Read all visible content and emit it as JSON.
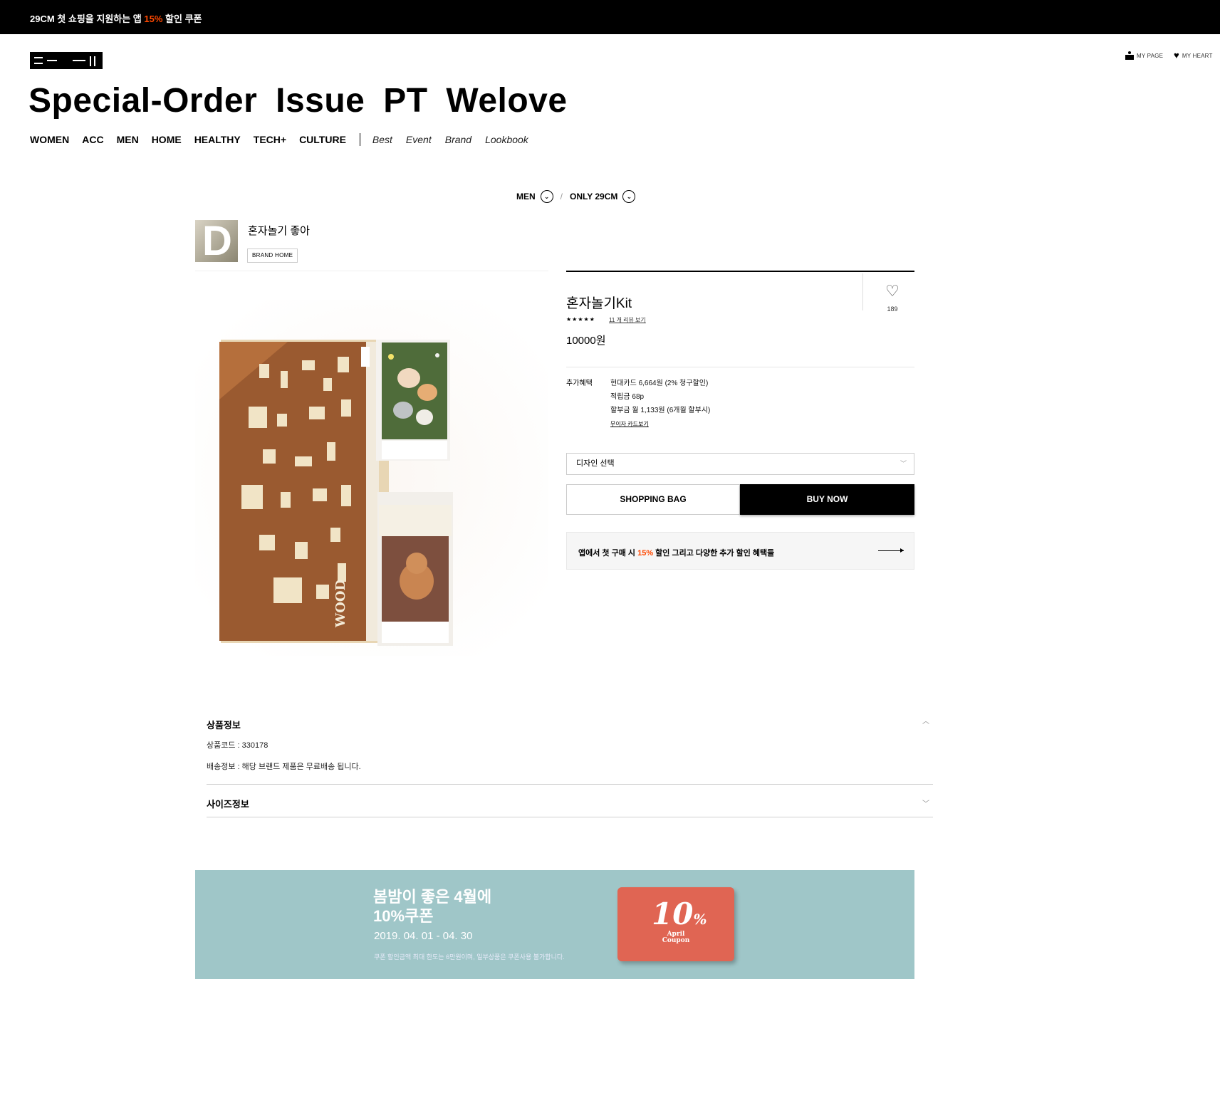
{
  "topbar": {
    "promo_prefix": "29CM 첫 쇼핑을 지원하는 앱 ",
    "promo_accent": "15%",
    "promo_suffix": " 할인 쿠폰",
    "accent_color": "#ff4800"
  },
  "header": {
    "logo_icon": "29cm-logo-icon",
    "utility": [
      {
        "label": "MY PAGE",
        "icon": "person-icon"
      },
      {
        "label": "MY HEART",
        "icon": "heart-icon"
      }
    ],
    "hero_title": "Special-Order  Issue  PT  Welove",
    "nav_main": [
      "WOMEN",
      "ACC",
      "MEN",
      "HOME",
      "HEALTHY",
      "TECH+",
      "CULTURE"
    ],
    "nav_sub": [
      "Best",
      "Event",
      "Brand",
      "Lookbook"
    ]
  },
  "breadcrumb": {
    "category": "MEN",
    "subcategory": "ONLY 29CM",
    "separator": "/"
  },
  "brand": {
    "name": "혼자놀기 좋아",
    "home_button": "BRAND HOME",
    "logo_letter": "D"
  },
  "product": {
    "name": "혼자놀기Kit",
    "stars": "★★★★★",
    "review_link": "11 개 리뷰 보기",
    "like_count": "189",
    "price": "10000원",
    "benefit_label": "추가혜택",
    "benefits": [
      "현대카드 6,664원 (2% 청구할인)",
      "적립금 68p",
      "할부금 월 1,133원 (6개월 할부시)"
    ],
    "card_link": "무이자 카드보기",
    "select_placeholder": "디자인 선택",
    "shopping_bag": "SHOPPING BAG",
    "buy_now": "BUY NOW",
    "app_banner_prefix": "앱에서 첫 구매 시 ",
    "app_banner_accent": "15%",
    "app_banner_suffix": " 할인 그리고 다양한 추가 할인 혜택들"
  },
  "accordion": {
    "info_title": "상품정보",
    "product_code": "상품코드 : 330178",
    "shipping": "배송정보 : 해당 브랜드 제품은 무료배송 됩니다.",
    "size_title": "사이즈정보"
  },
  "coupon_banner": {
    "headline_1": "봄밤이 좋은 4월에",
    "headline_2": "10%쿠폰",
    "date_range": "2019. 04. 01 - 04. 30",
    "note": "쿠폰 할인금액 최대 한도는 6만원이며, 일부상품은 쿠폰사용 불가합니다.",
    "card_big": "10",
    "card_pct": "%",
    "card_line1": "April",
    "card_line2": "Coupon",
    "bg_color": "#9fc6c8",
    "card_color": "#e06553"
  }
}
